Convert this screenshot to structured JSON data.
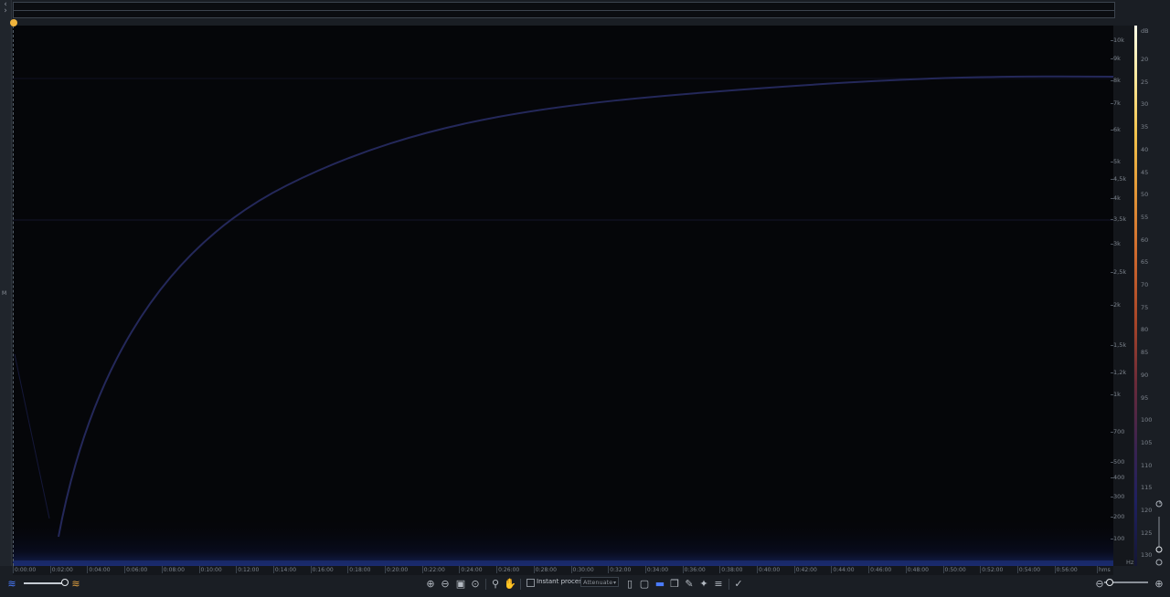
{
  "channel_label": "M",
  "icons": {
    "collapse": "collapse-icon",
    "waveform_view": "waveform-icon",
    "spectrogram_view": "spectrogram-icon",
    "zoom_in": "zoom-in-icon",
    "zoom_out": "zoom-out-icon",
    "zoom_selection": "zoom-selection-icon",
    "zoom_fit": "zoom-fit-icon",
    "magnify": "magnify-icon",
    "hand": "hand-icon",
    "time_select": "time-select-icon",
    "freq_select": "frequency-select-icon",
    "rect_select": "rectangle-select-icon",
    "lasso": "lasso-icon",
    "brush": "brush-icon",
    "magic_wand": "magic-wand-icon",
    "harmonic": "harmonic-select-icon",
    "checkmark": "checkmark-icon"
  },
  "colors": {
    "playhead": "#f0b43c",
    "sweep": "#24285a",
    "accent": "#4a7cff"
  },
  "freq_axis": {
    "unit": "Hz",
    "ticks": [
      "10k",
      "9k",
      "8k",
      "7k",
      "6k",
      "5k",
      "4,5k",
      "4k",
      "3,5k",
      "3k",
      "2,5k",
      "2k",
      "1,5k",
      "1,2k",
      "1k",
      "700",
      "500",
      "400",
      "300",
      "200",
      "100"
    ]
  },
  "db_axis": {
    "unit": "dB",
    "ticks": [
      "20",
      "25",
      "30",
      "35",
      "40",
      "45",
      "50",
      "55",
      "60",
      "65",
      "70",
      "75",
      "80",
      "85",
      "90",
      "95",
      "100",
      "105",
      "110",
      "115",
      "120",
      "125",
      "130"
    ]
  },
  "time_axis": {
    "unit": "hms",
    "ticks": [
      "0:00:00",
      "0:02:00",
      "0:04:00",
      "0:06:00",
      "0:08:00",
      "0:10:00",
      "0:12:00",
      "0:14:00",
      "0:16:00",
      "0:18:00",
      "0:20:00",
      "0:22:00",
      "0:24:00",
      "0:26:00",
      "0:28:00",
      "0:30:00",
      "0:32:00",
      "0:34:00",
      "0:36:00",
      "0:38:00",
      "0:40:00",
      "0:42:00",
      "0:44:00",
      "0:46:00",
      "0:48:00",
      "0:50:00",
      "0:52:00",
      "0:54:00",
      "0:56:00"
    ]
  },
  "toolbar": {
    "instant_process_label": "Instant process",
    "instant_process_checked": false,
    "mode_value": "Attenuate"
  }
}
